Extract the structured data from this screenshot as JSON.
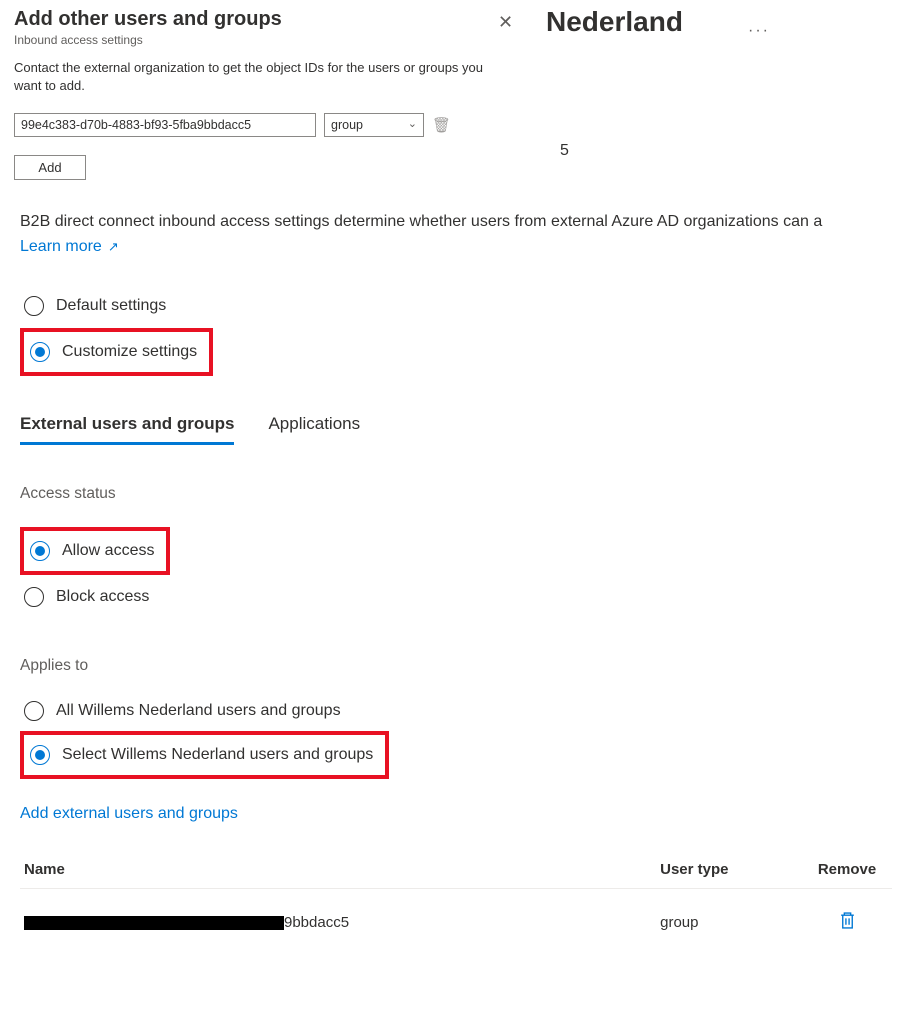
{
  "panel": {
    "title": "Add other users and groups",
    "subtitle": "Inbound access settings",
    "close_symbol": "✕",
    "instruction": "Contact the external organization to get the object IDs for the users or groups you want to add.",
    "object_id_value": "99e4c383-d70b-4883-bf93-5fba9bbdacc5",
    "type_select": "group",
    "add_button": "Add"
  },
  "page": {
    "org_name": "Nederland",
    "stray_char": "5"
  },
  "main": {
    "intro": "B2B direct connect inbound access settings determine whether users from external Azure AD organizations can a",
    "learn_more": "Learn more",
    "settings_mode": {
      "default_label": "Default settings",
      "customize_label": "Customize settings"
    },
    "tabs": {
      "external": "External users and groups",
      "applications": "Applications"
    },
    "access_status": {
      "heading": "Access status",
      "allow": "Allow access",
      "block": "Block access"
    },
    "applies_to": {
      "heading": "Applies to",
      "all": "All Willems Nederland users and groups",
      "select": "Select Willems Nederland users and groups"
    },
    "add_link": "Add external users and groups",
    "table": {
      "col_name": "Name",
      "col_type": "User type",
      "col_remove": "Remove",
      "row0": {
        "name_suffix": "9bbdacc5",
        "type": "group"
      }
    }
  }
}
